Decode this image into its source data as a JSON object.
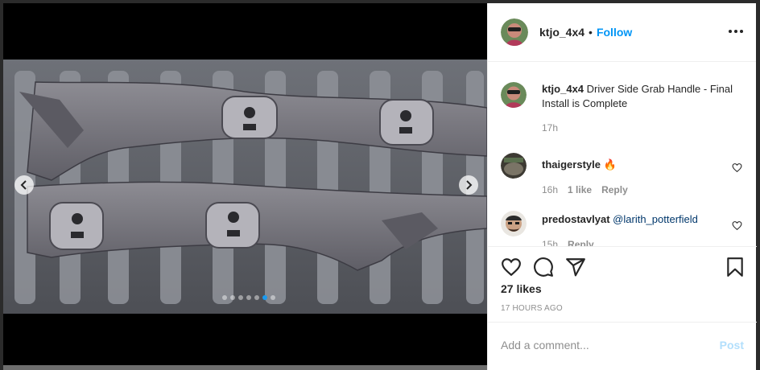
{
  "post": {
    "author": "ktjo_4x4",
    "separator": "•",
    "follow_label": "Follow",
    "more_icon": "more-options-icon"
  },
  "media": {
    "nav_prev_icon": "chevron-left-icon",
    "nav_next_icon": "chevron-right-icon",
    "carousel_total": 7,
    "carousel_active": 6
  },
  "comments": [
    {
      "username": "ktjo_4x4",
      "text": "Driver Side Grab Handle - Final Install is Complete",
      "time": "17h"
    },
    {
      "username": "thaigerstyle",
      "emoji": "🔥",
      "time": "16h",
      "likes": "1 like",
      "reply": "Reply"
    },
    {
      "username": "predostavlyat",
      "mention": "@larith_potterfield",
      "time": "15h",
      "reply": "Reply"
    }
  ],
  "actions": {
    "like_icon": "heart-icon",
    "comment_icon": "comment-icon",
    "share_icon": "paper-plane-icon",
    "save_icon": "bookmark-icon",
    "likes_count": "27 likes",
    "posted_ago": "17 HOURS AGO"
  },
  "composer": {
    "placeholder": "Add a comment...",
    "post_label": "Post"
  },
  "colors": {
    "accent": "#0095f6",
    "post_disabled": "#b2dffc",
    "carousel_active": "#1a9af0"
  }
}
